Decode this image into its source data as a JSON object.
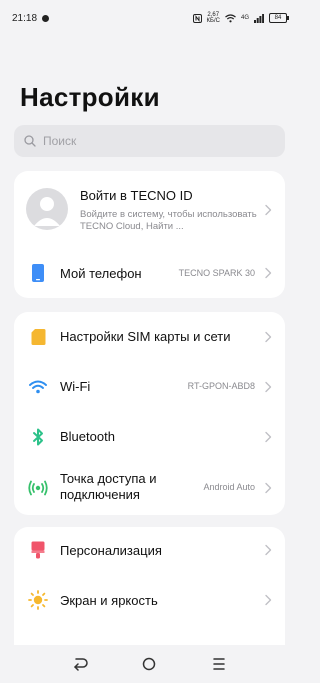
{
  "status_bar": {
    "time": "21:18",
    "net_speed_value": "2,67",
    "net_speed_unit": "КБ/С",
    "network_type": "4G",
    "battery": "84"
  },
  "page_title": "Настройки",
  "search": {
    "placeholder": "Поиск"
  },
  "account": {
    "title": "Войти в TECNO ID",
    "subtitle": "Войдите в систему, чтобы использовать TECNO Cloud, Найти ..."
  },
  "my_phone": {
    "label": "Мой телефон",
    "value": "TECNO SPARK 30"
  },
  "connectivity": [
    {
      "label": "Настройки SIM карты и сети",
      "value": ""
    },
    {
      "label": "Wi-Fi",
      "value": "RT-GPON-ABD8"
    },
    {
      "label": "Bluetooth",
      "value": ""
    },
    {
      "label": "Точка доступа и подключения",
      "value": "Android Auto"
    }
  ],
  "display_group": [
    {
      "label": "Персонализация",
      "value": ""
    },
    {
      "label": "Экран и яркость",
      "value": ""
    }
  ],
  "colors": {
    "background": "#f3f3f5",
    "card": "#ffffff",
    "phone_icon": "#3e8ef7",
    "sim_icon": "#f5b731",
    "wifi_icon": "#2f8ff0",
    "bluetooth_icon": "#2dc28a",
    "hotspot_icon": "#36c06b",
    "personalization_icon": "#f0546a",
    "brightness_icon": "#f6b82e"
  }
}
